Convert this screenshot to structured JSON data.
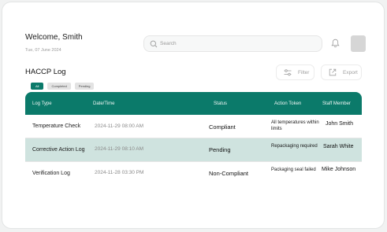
{
  "header": {
    "welcome": "Welcome, Smith",
    "date": "Tue, 07 June 2024",
    "search_placeholder": "Search"
  },
  "page": {
    "title": "HACCP Log"
  },
  "toolbar": {
    "filter_label": "Filter",
    "export_label": "Export"
  },
  "tabs": [
    {
      "label": "All",
      "active": true
    },
    {
      "label": "Completed",
      "active": false
    },
    {
      "label": "Pending",
      "active": false
    }
  ],
  "table": {
    "columns": [
      "Log Type",
      "Date/Time",
      "Status",
      "Action Token",
      "Staff Member"
    ],
    "rows": [
      {
        "log_type": "Temperature Check",
        "datetime": "2024-11-29 08:00 AM",
        "status": "Compliant",
        "action": "All temperatures within limits",
        "staff": "John Smith"
      },
      {
        "log_type": "Corrective Action Log",
        "datetime": "2024-11-29 08:10 AM",
        "status": "Pending",
        "action": "Repackaging required",
        "staff": "Sarah White"
      },
      {
        "log_type": "Verification Log",
        "datetime": "2024-11-28 03:30 PM",
        "status": "Non-Compliant",
        "action": "Packaging seal failed",
        "staff": "Mike Johnson"
      }
    ]
  },
  "colors": {
    "accent": "#0b7a6a",
    "highlight_row": "#cfe3df"
  },
  "icons": [
    "search-icon",
    "bell-icon",
    "filter-icon",
    "export-icon"
  ]
}
